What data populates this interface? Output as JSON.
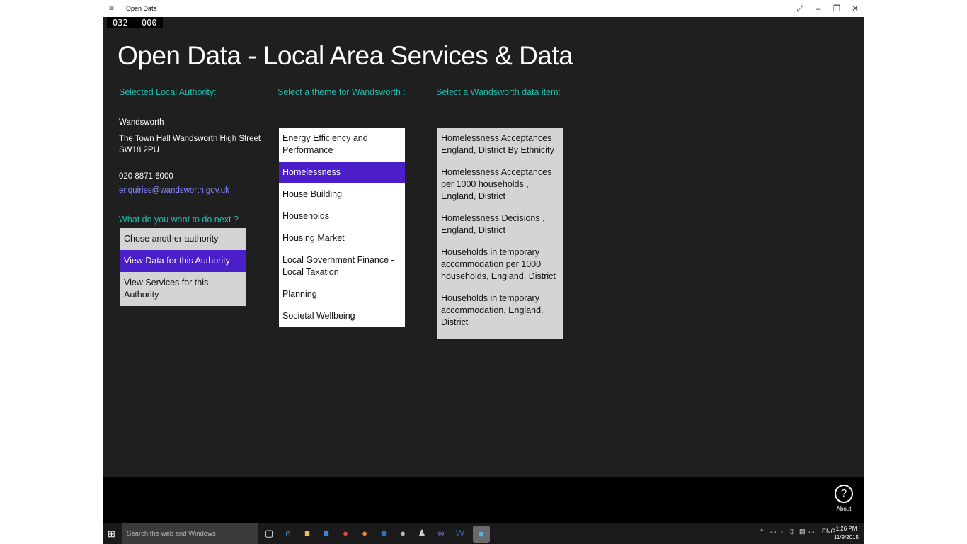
{
  "window": {
    "title": "Open Data",
    "controls": {
      "restore": "⤢",
      "minimize": "–",
      "maximize": "❐",
      "close": "✕"
    },
    "counter": [
      "032",
      "000"
    ]
  },
  "app": {
    "title": "Open Data - Local Area Services & Data",
    "authority_label": "Selected Local Authority:",
    "theme_label": "Select a theme for Wandsworth :",
    "dataitem_label": "Select a Wandsworth data item:",
    "authority": {
      "name": "Wandsworth",
      "address_line1": "The Town Hall Wandsworth High Street",
      "address_line2": "SW18 2PU",
      "phone": "020 8871 6000",
      "email": "enquiries@wandsworth.gov.uk"
    },
    "next_label": "What do you want to do next ?",
    "actions": [
      {
        "label": "Chose another authority",
        "selected": false
      },
      {
        "label": "View Data for this Authority",
        "selected": true
      },
      {
        "label": "View Services for this Authority",
        "selected": false
      }
    ],
    "themes": [
      {
        "label": "Energy Efficiency and Performance",
        "selected": false
      },
      {
        "label": "Homelessness",
        "selected": true
      },
      {
        "label": "House Building",
        "selected": false
      },
      {
        "label": "Households",
        "selected": false
      },
      {
        "label": "Housing Market",
        "selected": false
      },
      {
        "label": "Local Government Finance - Local Taxation",
        "selected": false
      },
      {
        "label": "Planning",
        "selected": false
      },
      {
        "label": "Societal Wellbeing",
        "selected": false
      }
    ],
    "data_items": [
      {
        "label": "Homelessness Acceptances England, District By Ethnicity"
      },
      {
        "label": "Homelessness Acceptances per 1000 households , England, District"
      },
      {
        "label": "Homelessness Decisions , England, District"
      },
      {
        "label": "Households in temporary accommodation per 1000 households, England, District"
      },
      {
        "label": "Households in temporary accommodation,  England, District"
      }
    ],
    "about_label": "About",
    "about_glyph": "?"
  },
  "taskbar": {
    "search_placeholder": "Search the web and Windows",
    "language": "ENG",
    "time": "1:26 PM",
    "date": "11/9/2015"
  },
  "colors": {
    "accent_teal": "#1fbdae",
    "selection_purple": "#4a1ec8",
    "email_link": "#8a86ff",
    "app_background": "#1f1f1f"
  }
}
